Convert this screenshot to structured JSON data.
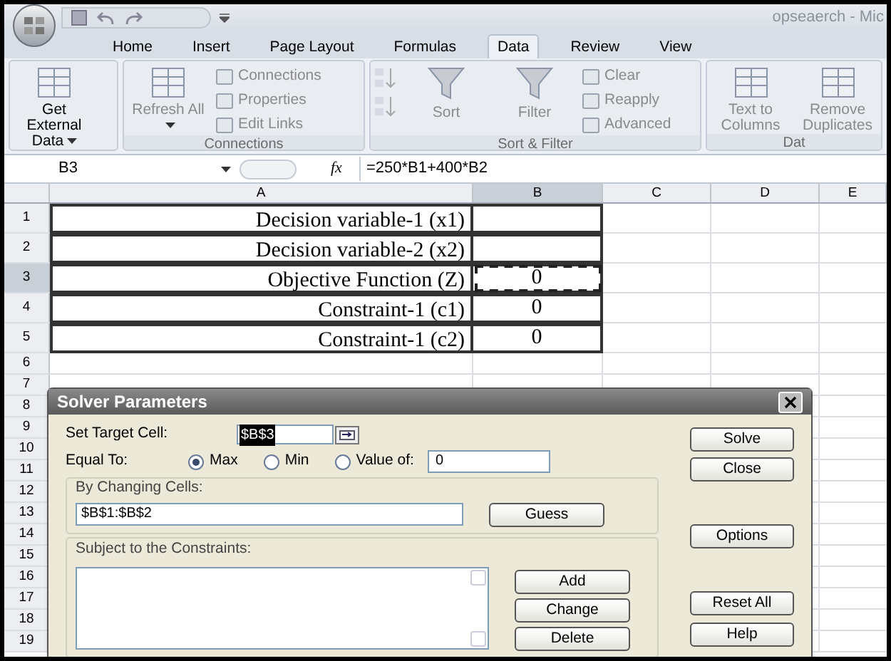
{
  "window": {
    "title": "opseaerch - Mic"
  },
  "ribbon_tabs": [
    {
      "label": "Home",
      "selected": false
    },
    {
      "label": "Insert",
      "selected": false
    },
    {
      "label": "Page Layout",
      "selected": false
    },
    {
      "label": "Formulas",
      "selected": false
    },
    {
      "label": "Data",
      "selected": true
    },
    {
      "label": "Review",
      "selected": false
    },
    {
      "label": "View",
      "selected": false
    }
  ],
  "ribbon_groups": [
    {
      "items": [
        {
          "kind": "large",
          "label": "Get External Data",
          "dropdown": true,
          "disabled": false
        }
      ]
    },
    {
      "label": "Connections",
      "items": [
        {
          "kind": "large",
          "label": "Refresh All",
          "dropdown": true,
          "disabled": true
        },
        {
          "kind": "small",
          "label": "Connections",
          "disabled": true
        },
        {
          "kind": "small",
          "label": "Properties",
          "disabled": true
        },
        {
          "kind": "small",
          "label": "Edit Links",
          "disabled": true
        }
      ]
    },
    {
      "label": "Sort & Filter",
      "items": [
        {
          "kind": "icon",
          "disabled": true
        },
        {
          "kind": "icon",
          "disabled": true
        },
        {
          "kind": "large",
          "label": "Sort",
          "dropdown": false,
          "disabled": true
        },
        {
          "kind": "large",
          "label": "Filter",
          "dropdown": false,
          "disabled": true
        },
        {
          "kind": "small",
          "label": "Clear",
          "disabled": true
        },
        {
          "kind": "small",
          "label": "Reapply",
          "disabled": true
        },
        {
          "kind": "small",
          "label": "Advanced",
          "disabled": true
        }
      ]
    },
    {
      "label": "Dat",
      "items": [
        {
          "kind": "large",
          "label": "Text to Columns",
          "dropdown": false,
          "disabled": true
        },
        {
          "kind": "large",
          "label": "Remove Duplicates",
          "dropdown": false,
          "disabled": true
        }
      ]
    }
  ],
  "formula_bar": {
    "name_box": "B3",
    "function_label": "fx",
    "formula": "=250*B1+400*B2"
  },
  "columns": [
    {
      "label": "A",
      "selected": false
    },
    {
      "label": "B",
      "selected": true
    },
    {
      "label": "C",
      "selected": false
    },
    {
      "label": "D",
      "selected": false
    },
    {
      "label": "E",
      "selected": false
    }
  ],
  "rows": [
    {
      "header": "1",
      "label": "Decision variable-1 (x1)",
      "bordered": true,
      "selected": false
    },
    {
      "header": "2",
      "label": "Decision variable-2 (x2)",
      "bordered": true,
      "selected": false
    },
    {
      "header": "3",
      "label": "Objective Function (Z)",
      "value": "0",
      "bordered": true,
      "selected": true
    },
    {
      "header": "4",
      "label": "Constraint-1 (c1)",
      "value": "0",
      "bordered": true,
      "selected": false
    },
    {
      "header": "5",
      "label": "Constraint-1 (c2)",
      "value": "0",
      "bordered": true,
      "selected": false
    },
    {
      "header": "6",
      "bordered": false,
      "selected": false
    },
    {
      "header": "7",
      "bordered": false,
      "selected": false
    },
    {
      "header": "8",
      "bordered": false,
      "selected": false
    },
    {
      "header": "9",
      "bordered": false,
      "selected": false
    },
    {
      "header": "10",
      "bordered": false,
      "selected": false
    },
    {
      "header": "11",
      "bordered": false,
      "selected": false
    },
    {
      "header": "12",
      "bordered": false,
      "selected": false
    },
    {
      "header": "13",
      "bordered": false,
      "selected": false
    },
    {
      "header": "14",
      "bordered": false,
      "selected": false
    },
    {
      "header": "15",
      "bordered": false,
      "selected": false
    },
    {
      "header": "16",
      "bordered": false,
      "selected": false
    },
    {
      "header": "17",
      "bordered": false,
      "selected": false
    },
    {
      "header": "18",
      "bordered": false,
      "selected": false
    },
    {
      "header": "19",
      "bordered": false,
      "selected": false
    }
  ],
  "dialog": {
    "title": "Solver Parameters",
    "target_label": "Set Target Cell:",
    "target_value": "$B$3",
    "equal_label": "Equal To:",
    "options": [
      {
        "label": "Max",
        "selected": true
      },
      {
        "label": "Min",
        "selected": false
      },
      {
        "label": "Value of:",
        "selected": false
      }
    ],
    "value_field": "0",
    "changing_label": "By Changing Cells:",
    "changing_value": "$B$1:$B$2",
    "guess_button": "Guess",
    "constraints_label": "Subject to the Constraints:",
    "constraint_buttons": [
      "Add",
      "Change",
      "Delete"
    ],
    "side_buttons": [
      {
        "label": "Solve"
      },
      {
        "label": "Close"
      },
      {
        "label": "Options"
      },
      {
        "label": "Reset All"
      },
      {
        "label": "Help"
      }
    ]
  }
}
